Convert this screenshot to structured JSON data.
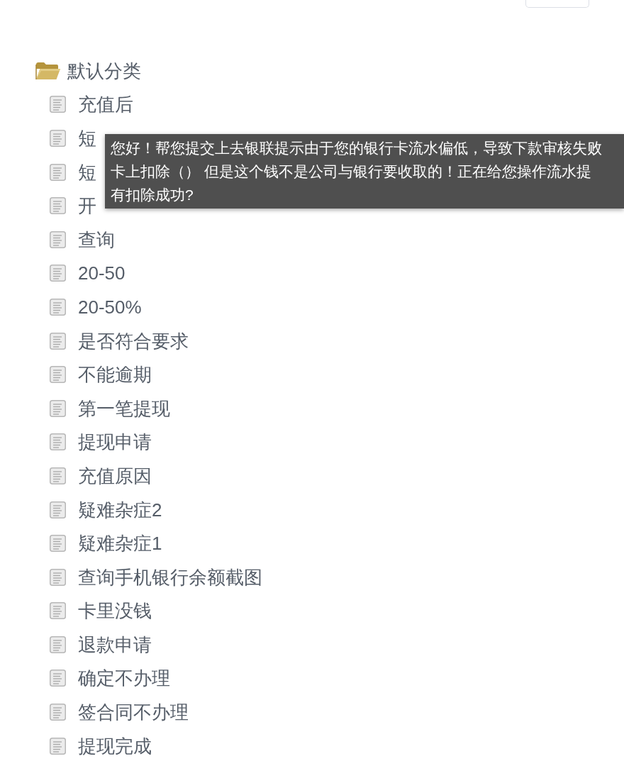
{
  "tree": [
    {
      "label": "默认分类",
      "expanded": true,
      "children": [
        {
          "label": "充值后"
        },
        {
          "label": "短"
        },
        {
          "label": "短"
        },
        {
          "label": "开"
        },
        {
          "label": "查询"
        },
        {
          "label": "20-50"
        },
        {
          "label": "20-50%"
        },
        {
          "label": "是否符合要求"
        },
        {
          "label": "不能逾期"
        },
        {
          "label": "第一笔提现"
        },
        {
          "label": "提现申请"
        },
        {
          "label": "充值原因"
        },
        {
          "label": "疑难杂症2"
        },
        {
          "label": "疑难杂症1"
        },
        {
          "label": "查询手机银行余额截图"
        },
        {
          "label": "卡里没钱"
        },
        {
          "label": "退款申请"
        },
        {
          "label": "确定不办理"
        },
        {
          "label": "签合同不办理"
        },
        {
          "label": "提现完成"
        }
      ]
    }
  ],
  "tooltip": {
    "lines": [
      "您好！帮您提交上去银联提示由于您的银行卡流水偏低，导致下款审核失败",
      "卡上扣除（） 但是这个钱不是公司与银行要收取的！正在给您操作流水提",
      "有扣除成功?"
    ]
  }
}
